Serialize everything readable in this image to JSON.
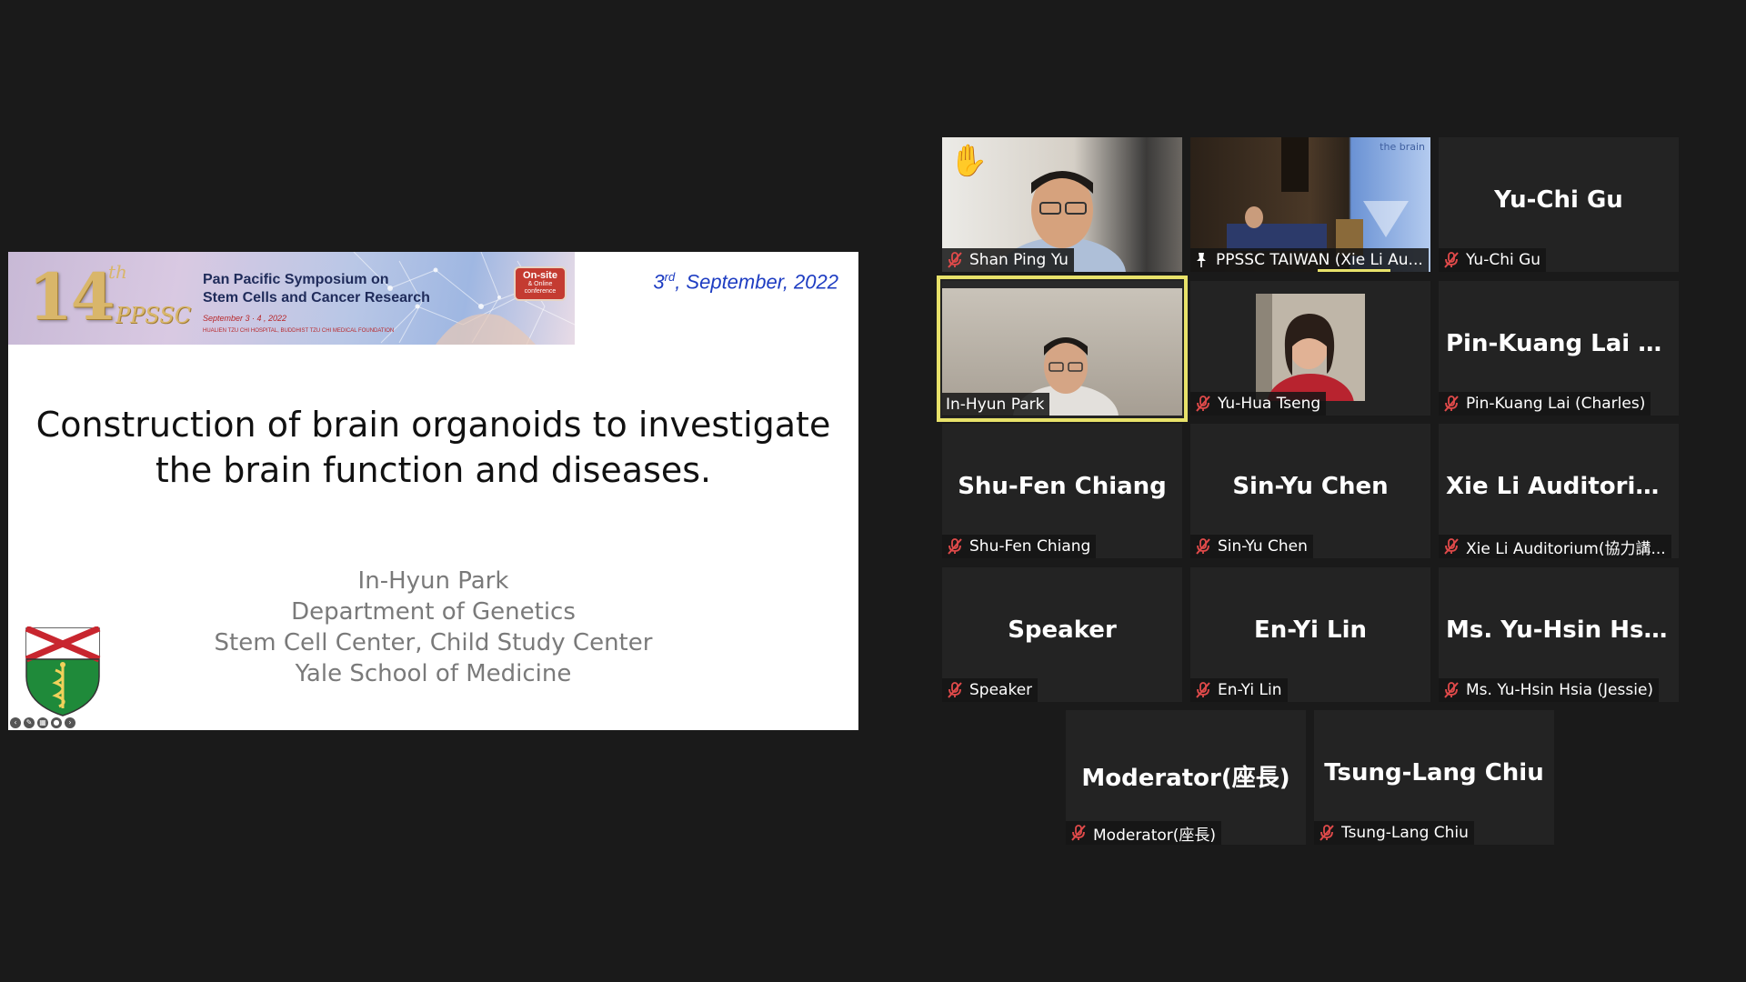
{
  "slide": {
    "banner": {
      "number": "14",
      "number_suffix": "th",
      "brand": "PPSSC",
      "title_line1": "Pan Pacific Symposium on",
      "title_line2": "Stem Cells and Cancer Research",
      "dates": "September 3 · 4 , 2022",
      "organizer": "HUALIEN TZU CHI HOSPITAL, BUDDHIST TZU CHI MEDICAL FOUNDATION",
      "badge_main": "On-site",
      "badge_sub": "& Online conference"
    },
    "date_prefix": "3",
    "date_sup": "rd",
    "date_rest": ", September, 2022",
    "title_line1": "Construction of brain organoids to investigate",
    "title_line2": "the brain function and diseases.",
    "author": {
      "name": "In-Hyun Park",
      "dept": "Department of Genetics",
      "center": "Stem Cell Center, Child Study Center",
      "school": "Yale School of Medicine"
    }
  },
  "participants": [
    {
      "label": "Shan Ping Yu",
      "big": "",
      "video": true,
      "muted": true,
      "hand_raised": true
    },
    {
      "label": "PPSSC TAIWAN (Xie Li Au...",
      "big": "",
      "video": true,
      "muted": false,
      "pinned": true,
      "overlay_text": "the brain"
    },
    {
      "label": "Yu-Chi Gu",
      "big": "Yu-Chi Gu",
      "video": false,
      "muted": true
    },
    {
      "label": "In-Hyun Park",
      "big": "",
      "video": true,
      "muted": false,
      "active_speaker": true
    },
    {
      "label": "Yu-Hua Tseng",
      "big": "",
      "video": true,
      "muted": true
    },
    {
      "label": "Pin-Kuang Lai (Charles)",
      "big": "Pin-Kuang Lai (...",
      "video": false,
      "muted": true
    },
    {
      "label": "Shu-Fen Chiang",
      "big": "Shu-Fen Chiang",
      "video": false,
      "muted": true
    },
    {
      "label": "Sin-Yu Chen",
      "big": "Sin-Yu Chen",
      "video": false,
      "muted": true
    },
    {
      "label": "Xie Li Auditorium(協力講...",
      "big": "Xie Li Auditoriu...",
      "video": false,
      "muted": true
    },
    {
      "label": "Speaker",
      "big": "Speaker",
      "video": false,
      "muted": true
    },
    {
      "label": "En-Yi Lin",
      "big": "En-Yi Lin",
      "video": false,
      "muted": true
    },
    {
      "label": "Ms. Yu-Hsin Hsia (Jessie)",
      "big": "Ms. Yu-Hsin Hsi...",
      "video": false,
      "muted": true
    },
    {
      "label": "Moderator(座長)",
      "big": "Moderator(座長)",
      "video": false,
      "muted": true
    },
    {
      "label": "Tsung-Lang Chiu",
      "big": "Tsung-Lang Chiu",
      "video": false,
      "muted": true
    }
  ],
  "colors": {
    "background": "#1a1a1a",
    "tile": "#232323",
    "active_speaker_border": "#e8e26a",
    "muted_icon": "#e04a4a",
    "slide_date": "#1d3cc2"
  }
}
